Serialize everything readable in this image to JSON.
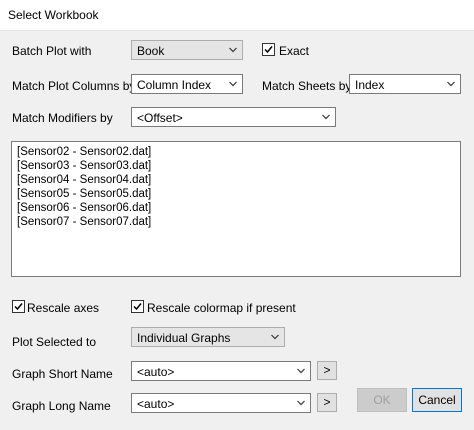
{
  "window": {
    "title": "Select Workbook"
  },
  "form": {
    "batch_plot_label": "Batch Plot with",
    "batch_plot_value": "Book",
    "exact_label": "Exact",
    "match_plot_columns_label": "Match Plot Columns by",
    "match_plot_columns_value": "Column Index",
    "match_sheets_label": "Match Sheets by",
    "match_sheets_value": "Index",
    "match_modifiers_label": "Match Modifiers by",
    "match_modifiers_value": "<Offset>",
    "rescale_axes_label": "Rescale axes",
    "rescale_colormap_label": "Rescale colormap if present",
    "plot_selected_label": "Plot Selected to",
    "plot_selected_value": "Individual Graphs",
    "graph_short_name_label": "Graph Short Name",
    "graph_short_name_value": "<auto>",
    "graph_long_name_label": "Graph Long Name",
    "graph_long_name_value": "<auto>",
    "insert_button_label": ">"
  },
  "list": {
    "items": [
      "[Sensor02 - Sensor02.dat]",
      "[Sensor03 - Sensor03.dat]",
      "[Sensor04 - Sensor04.dat]",
      "[Sensor05 - Sensor05.dat]",
      "[Sensor06 - Sensor06.dat]",
      "[Sensor07 - Sensor07.dat]"
    ]
  },
  "buttons": {
    "ok": "OK",
    "cancel": "Cancel"
  },
  "checks": {
    "exact": true,
    "rescale_axes": true,
    "rescale_colormap": true
  },
  "colors": {
    "focus": "#0078d7",
    "disabled_text": "#a0a0a0"
  }
}
